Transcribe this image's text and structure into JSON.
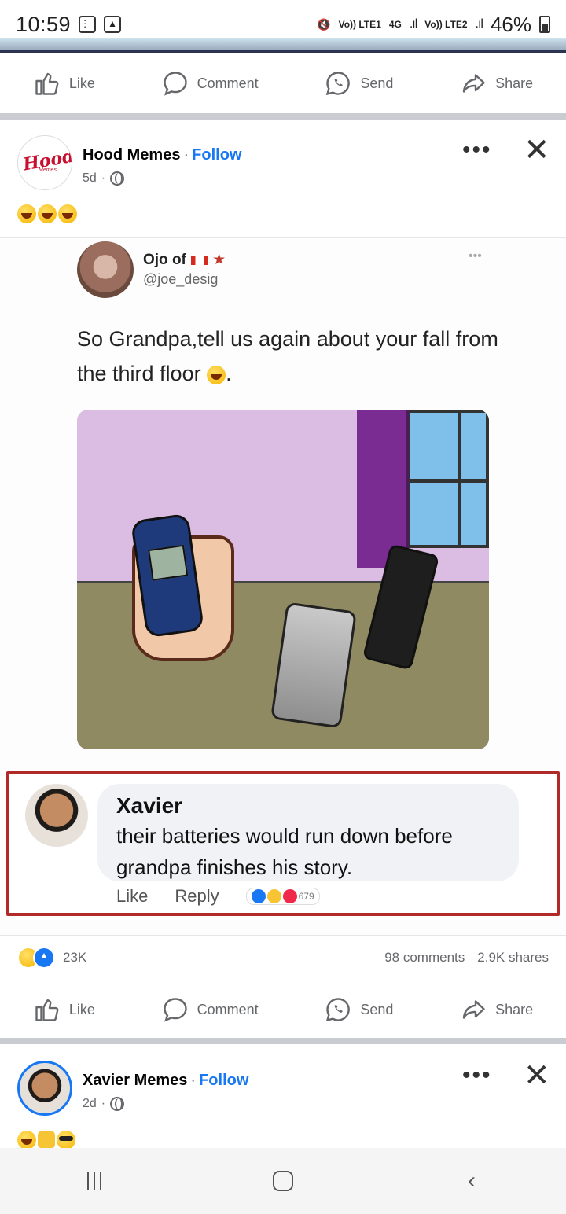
{
  "status_bar": {
    "time": "10:59",
    "network_1": "Vo)) LTE1",
    "network_type": "4G",
    "network_2": "Vo)) LTE2",
    "battery": "46%"
  },
  "actions": {
    "like": "Like",
    "comment": "Comment",
    "send": "Send",
    "share": "Share"
  },
  "post1": {
    "page_name": "Hood Memes",
    "follow": "Follow",
    "time": "5d",
    "avatar_text": "Hood",
    "avatar_sub": "Memes",
    "meme": {
      "tweet_name": "Ojo of",
      "tweet_handle": "@joe_desig",
      "tweet_text": "So Grandpa,tell us again about your fall from the third floor",
      "comment_name": "Xavier",
      "comment_text": "their batteries would run down before grandpa finishes his story.",
      "comment_like": "Like",
      "comment_reply": "Reply",
      "comment_reactions": "679"
    },
    "reactions_count": "23K",
    "comments_count": "98 comments",
    "shares_count": "2.9K shares"
  },
  "post2": {
    "page_name": "Xavier Memes",
    "follow": "Follow",
    "time": "2d"
  },
  "colors": {
    "facebook_blue": "#1877f2",
    "comment_highlight": "#b12a2a",
    "divider": "#c9ccd1"
  }
}
